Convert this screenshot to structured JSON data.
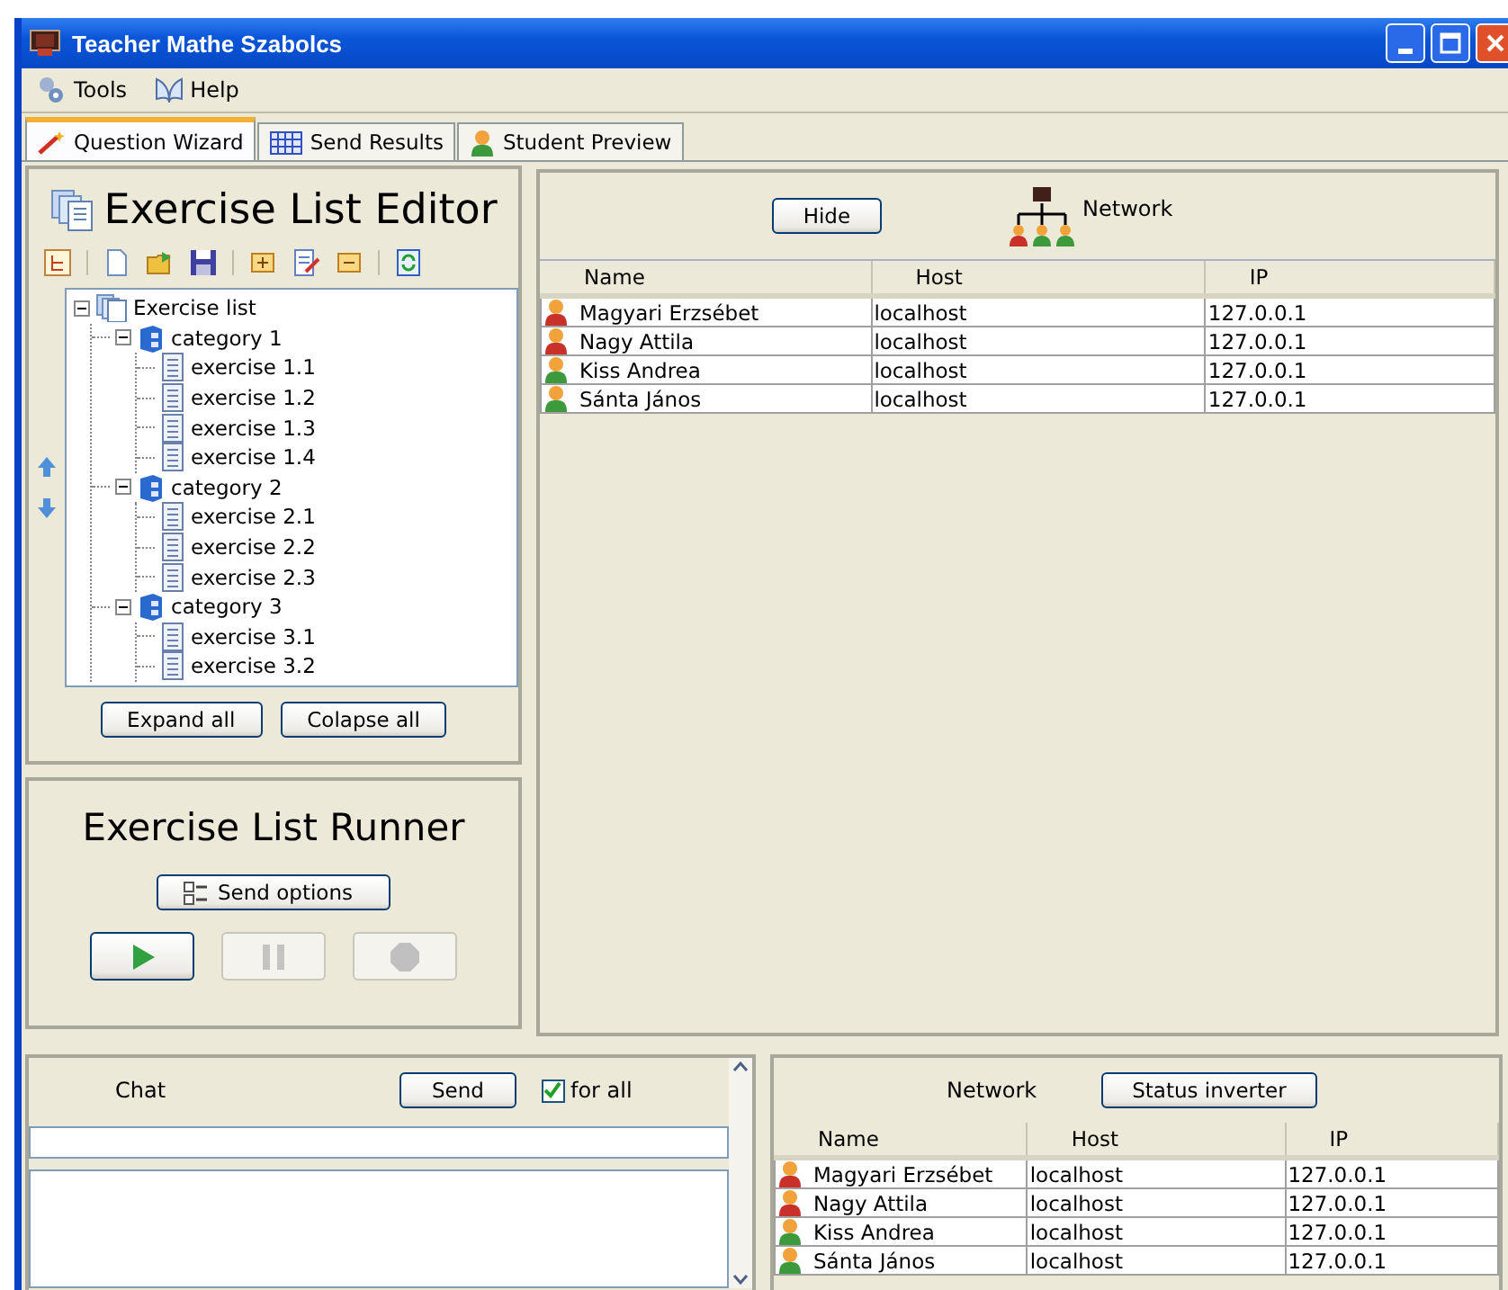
{
  "window": {
    "title": "Teacher Mathe Szabolcs"
  },
  "menu": [
    {
      "label": "Tools"
    },
    {
      "label": "Help"
    }
  ],
  "tabs": [
    {
      "label": "Question Wizard",
      "selected": true
    },
    {
      "label": "Send Results",
      "selected": false
    },
    {
      "label": "Student Preview",
      "selected": false
    }
  ],
  "editor": {
    "title": "Exercise List Editor",
    "tree": [
      {
        "label": "Exercise list",
        "kind": "list",
        "expanded": true,
        "children": [
          {
            "label": "category 1",
            "kind": "category",
            "expanded": true,
            "children": [
              {
                "label": "exercise 1.1",
                "kind": "exercise"
              },
              {
                "label": "exercise 1.2",
                "kind": "exercise"
              },
              {
                "label": "exercise 1.3",
                "kind": "exercise"
              },
              {
                "label": "exercise 1.4",
                "kind": "exercise"
              }
            ]
          },
          {
            "label": "category 2",
            "kind": "category",
            "expanded": true,
            "children": [
              {
                "label": "exercise 2.1",
                "kind": "exercise"
              },
              {
                "label": "exercise 2.2",
                "kind": "exercise"
              },
              {
                "label": "exercise 2.3",
                "kind": "exercise"
              }
            ]
          },
          {
            "label": "category 3",
            "kind": "category",
            "expanded": true,
            "children": [
              {
                "label": "exercise 3.1",
                "kind": "exercise"
              },
              {
                "label": "exercise 3.2",
                "kind": "exercise"
              }
            ]
          }
        ]
      }
    ],
    "buttons": [
      "Expand all",
      "Colapse all"
    ]
  },
  "runner": {
    "title": "Exercise List Runner",
    "options_button": "Send options",
    "controls": [
      {
        "kind": "play",
        "disabled": false
      },
      {
        "kind": "pause",
        "disabled": true
      },
      {
        "kind": "stop",
        "disabled": true
      }
    ]
  },
  "network": {
    "hide_button": "Hide",
    "label": "Network",
    "table": {
      "columns": [
        "Name",
        "Host",
        "IP"
      ],
      "rows": [
        {
          "name": "Magyari Erzsébet",
          "host": "localhost",
          "ip": "127.0.0.1",
          "color": "#c8302a"
        },
        {
          "name": "Nagy Attila",
          "host": "localhost",
          "ip": "127.0.0.1",
          "color": "#c8302a"
        },
        {
          "name": "Kiss Andrea",
          "host": "localhost",
          "ip": "127.0.0.1",
          "color": "#3c9a3c"
        },
        {
          "name": "Sánta János",
          "host": "localhost",
          "ip": "127.0.0.1",
          "color": "#3c9a3c"
        }
      ]
    }
  },
  "chat": {
    "title": "Chat",
    "send_button": "Send",
    "for_all": {
      "label": "for all",
      "checked": true
    }
  },
  "network_panel": {
    "label": "Network",
    "button": "Status inverter",
    "table": {
      "columns": [
        "Name",
        "Host",
        "IP"
      ],
      "rows": [
        {
          "name": "Magyari Erzsébet",
          "host": "localhost",
          "ip": "127.0.0.1",
          "color": "#c8302a"
        },
        {
          "name": "Nagy Attila",
          "host": "localhost",
          "ip": "127.0.0.1",
          "color": "#c8302a"
        },
        {
          "name": "Kiss Andrea",
          "host": "localhost",
          "ip": "127.0.0.1",
          "color": "#3c9a3c"
        },
        {
          "name": "Sánta János",
          "host": "localhost",
          "ip": "127.0.0.1",
          "color": "#3c9a3c"
        }
      ]
    }
  }
}
